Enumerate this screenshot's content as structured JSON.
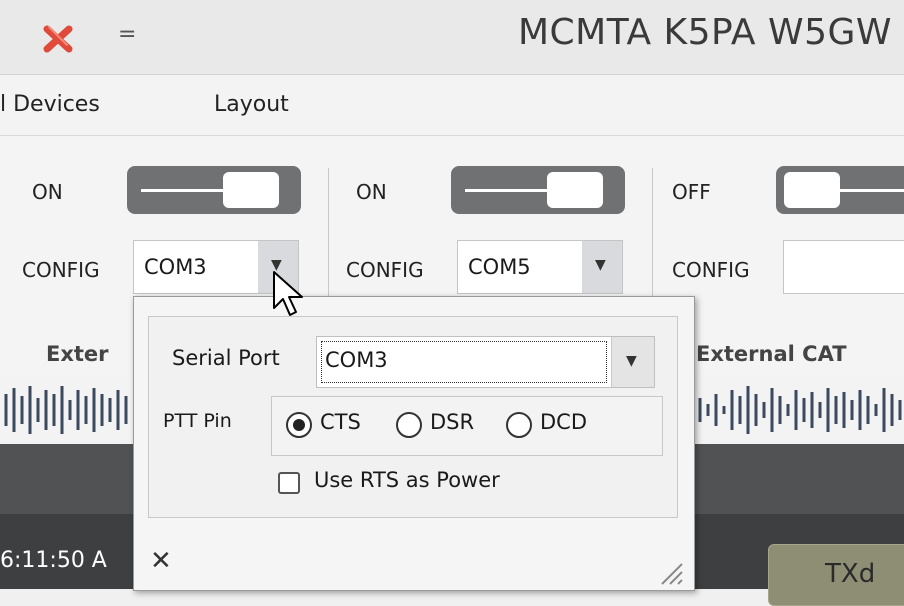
{
  "window": {
    "title": "MCMTA K5PA W5GW",
    "qat_glyph": "=",
    "close_icon": "close-x-icon"
  },
  "menu": {
    "items": [
      {
        "label": "l Devices"
      },
      {
        "label": "Layout"
      }
    ]
  },
  "devices": [
    {
      "state": "ON",
      "config_label": "CONFIG",
      "config_value": "COM3",
      "section": "Exter"
    },
    {
      "state": "ON",
      "config_label": "CONFIG",
      "config_value": "COM5",
      "section": ""
    },
    {
      "state": "OFF",
      "config_label": "CONFIG",
      "config_value": "",
      "section": "External CAT"
    }
  ],
  "status": {
    "clock": "6:11:50 A",
    "txd_label": "TXd"
  },
  "popup": {
    "serial_port_label": "Serial Port",
    "serial_port_value": "COM3",
    "ptt_pin_label": "PTT Pin",
    "ptt_options": [
      "CTS",
      "DSR",
      "DCD"
    ],
    "ptt_selected": "CTS",
    "use_rts_label": "Use RTS as Power",
    "use_rts_checked": false,
    "close_label": "✕"
  },
  "colors": {
    "toggle": "#6f7173",
    "close_x": "#e04a3a",
    "txd": "#8e8e75"
  }
}
